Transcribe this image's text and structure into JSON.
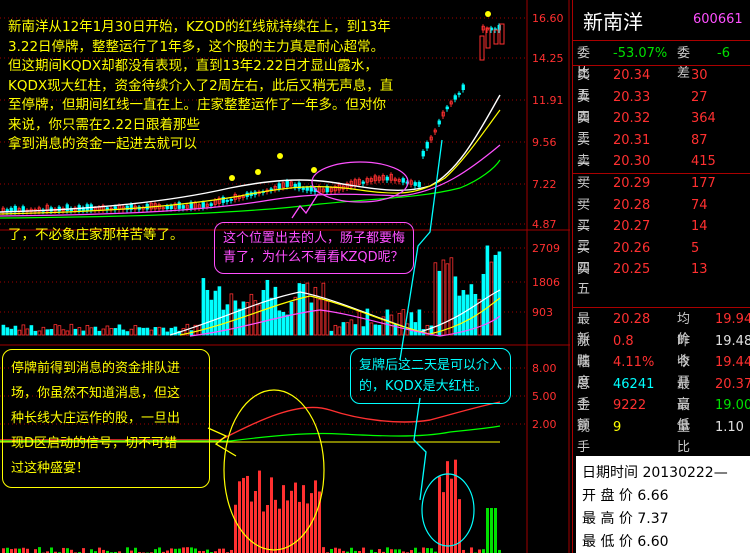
{
  "stock": {
    "name": "新南洋",
    "code": "600661"
  },
  "price_axis": [
    "16.60",
    "14.25",
    "11.91",
    "9.56",
    "7.22",
    "4.87"
  ],
  "volume_axis": [
    "2709",
    "1806",
    "903"
  ],
  "indicator_axis": [
    "8.00",
    "5.00",
    "2.00"
  ],
  "annotations": {
    "main_text": "新南洋从12年1月30日开始，KZQD的红线就持续在上，到13年\n3.22日停牌，整整运行了1年多，这个股的主力真是耐心超常。\n但这期间KQDX却都没有表现，直到13年2.22日才显山露水，\nKQDX现大红柱，资金待续介入了2周左右，此后又稍无声息，直\n至停牌，但期间红线一直在上。庄家整整运作了一年多。但对你\n来说，你只需在2.22日跟着那些\n拿到消息的资金一起进去就可以",
    "main_text_cont": "了，不必象庄家那样苦等了。",
    "pink_box": "这个位置出去的人，肠子都要悔\n青了，为什么不看看KZQD呢？",
    "yellow_box": "停牌前得到消息的资金排队进\n场，你虽然不知道消息，但这\n种长线大庄运作的股，一旦出\n现D区启动的信号，切不可错\n过这种盛宴！",
    "cyan_box": "复牌后这二天是可以介入\n的，KQDX是大红柱。"
  },
  "order_book": [
    {
      "label": "委比",
      "value": "-53.07%",
      "label2": "委差",
      "value2": "-6"
    },
    {
      "label": "卖五",
      "price": "20.34",
      "qty": "30"
    },
    {
      "label": "卖四",
      "price": "20.33",
      "qty": "27"
    },
    {
      "label": "卖三",
      "price": "20.32",
      "qty": "364"
    },
    {
      "label": "卖二",
      "price": "20.31",
      "qty": "87"
    },
    {
      "label": "卖一",
      "price": "20.30",
      "qty": "415"
    },
    {
      "label": "买一",
      "price": "20.29",
      "qty": "177"
    },
    {
      "label": "买二",
      "price": "20.28",
      "qty": "74"
    },
    {
      "label": "买三",
      "price": "20.27",
      "qty": "14"
    },
    {
      "label": "买四",
      "price": "20.26",
      "qty": "5"
    },
    {
      "label": "买五",
      "price": "20.25",
      "qty": "13"
    }
  ],
  "quote": [
    {
      "l1": "最新",
      "v1": "20.28",
      "l2": "均价",
      "v2": "19.94"
    },
    {
      "l1": "涨跌",
      "v1": "0.8",
      "l2": "昨收",
      "v2": "19.48"
    },
    {
      "l1": "幅度",
      "v1": "4.11%",
      "l2": "今开",
      "v2": "19.44"
    },
    {
      "l1": "总手",
      "v1": "46241",
      "l2": "最高",
      "v2": "20.37"
    },
    {
      "l1": "金额",
      "v1": "9222",
      "l2": "最低",
      "v2": "19.00"
    },
    {
      "l1": "现手",
      "v1": "9",
      "l2": "量比",
      "v2": "1.10"
    }
  ],
  "info": {
    "date_label": "日期时间",
    "date_value": "20130222—",
    "open_label": "开 盘 价",
    "open_value": "6.66",
    "high_label": "最 高 价",
    "high_value": "7.37",
    "low_label": "最 低 价",
    "low_value": "6.60"
  },
  "colors": {
    "up": "#ff3030",
    "down": "#00ffff",
    "grid": "#a00000",
    "ma1": "#ffffff",
    "ma2": "#ffff00",
    "ma3": "#ff50ff",
    "ma4": "#00ff00"
  }
}
